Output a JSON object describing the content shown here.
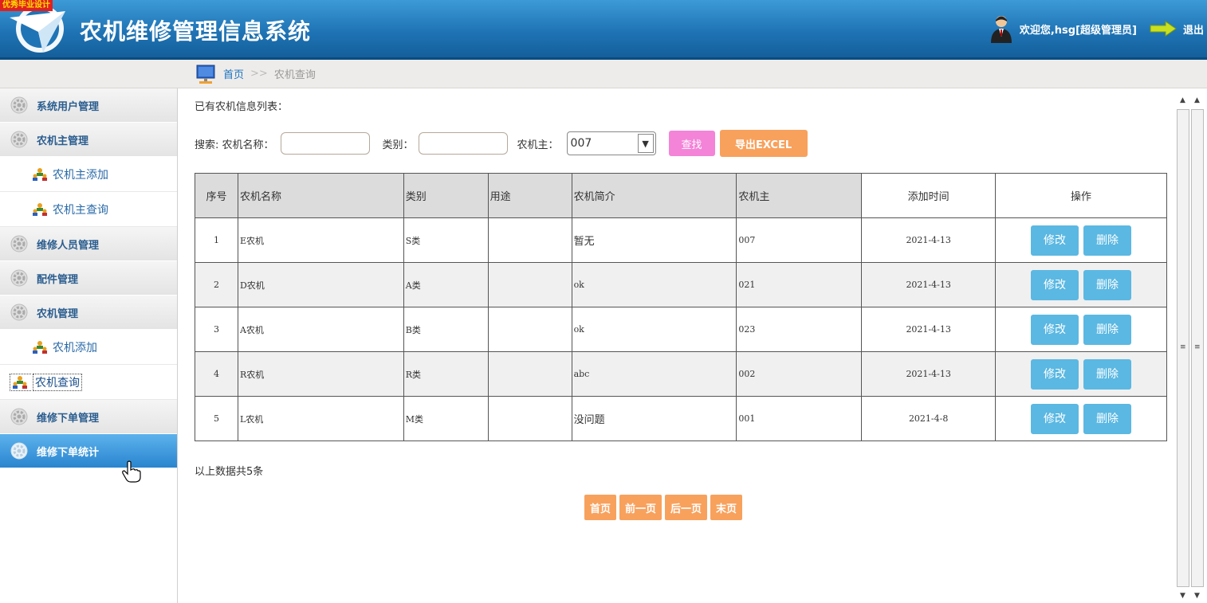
{
  "header": {
    "badge": "优秀毕业设计",
    "title": "农机维修管理信息系统",
    "welcome": "欢迎您,hsg[超级管理员]",
    "logout": "退出"
  },
  "breadcrumb": {
    "home": "首页",
    "separator": ">>",
    "current": "农机查询"
  },
  "sidebar": {
    "groups": [
      {
        "label": "系统用户管理"
      },
      {
        "label": "农机主管理",
        "items": [
          "农机主添加",
          "农机主查询"
        ]
      },
      {
        "label": "维修人员管理"
      },
      {
        "label": "配件管理"
      },
      {
        "label": "农机管理",
        "items": [
          "农机添加",
          "农机查询"
        ]
      },
      {
        "label": "维修下单管理"
      },
      {
        "label": "维修下单统计"
      }
    ]
  },
  "main": {
    "list_title": "已有农机信息列表：",
    "search": {
      "prefix": "搜索: 农机名称：",
      "name_value": "",
      "category_label": "类别：",
      "category_value": "",
      "owner_label": "农机主：",
      "owner_selected": "007",
      "find_button": "查找",
      "export_button": "导出EXCEL"
    },
    "columns": [
      "序号",
      "农机名称",
      "类别",
      "用途",
      "农机简介",
      "农机主",
      "添加时间",
      "操作"
    ],
    "rows": [
      {
        "no": "1",
        "name": "E农机",
        "category": "S类",
        "use": "",
        "intro": "暂无",
        "owner": "007",
        "time": "2021-4-13"
      },
      {
        "no": "2",
        "name": "D农机",
        "category": "A类",
        "use": "",
        "intro": "ok",
        "owner": "021",
        "time": "2021-4-13"
      },
      {
        "no": "3",
        "name": "A农机",
        "category": "B类",
        "use": "",
        "intro": "ok",
        "owner": "023",
        "time": "2021-4-13"
      },
      {
        "no": "4",
        "name": "R农机",
        "category": "R类",
        "use": "",
        "intro": "abc",
        "owner": "002",
        "time": "2021-4-13"
      },
      {
        "no": "5",
        "name": "L农机",
        "category": "M类",
        "use": "",
        "intro": "没问题",
        "owner": "001",
        "time": "2021-4-8"
      }
    ],
    "edit_label": "修改",
    "delete_label": "删除",
    "total": "以上数据共5条",
    "pager": [
      "首页",
      "前一页",
      "后一页",
      "末页"
    ]
  },
  "colors": {
    "header_blue": "#1f74b5",
    "find_pink": "#f384d8",
    "export_orange": "#f8a15d",
    "op_blue": "#5bb8e2",
    "menu_active": "#2a85cf"
  }
}
